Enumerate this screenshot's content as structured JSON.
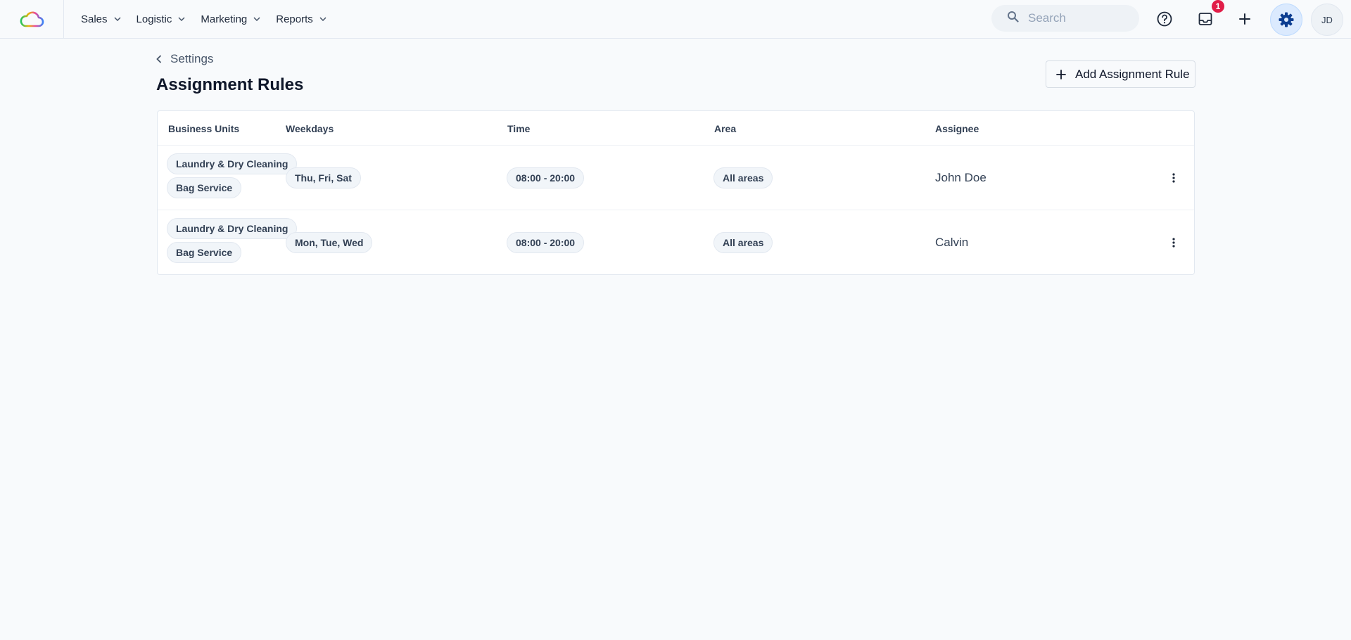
{
  "nav": {
    "items": [
      {
        "label": "Sales"
      },
      {
        "label": "Logistic"
      },
      {
        "label": "Marketing"
      },
      {
        "label": "Reports"
      }
    ]
  },
  "header": {
    "search_placeholder": "Search",
    "notification_count": "1",
    "avatar_initials": "JD",
    "accent_color": "#0b3d91",
    "badge_color": "#e11d48"
  },
  "page": {
    "back_label": "Settings",
    "title": "Assignment Rules",
    "add_button_label": "Add Assignment Rule"
  },
  "table": {
    "columns": [
      "Business Units",
      "Weekdays",
      "Time",
      "Area",
      "Assignee"
    ],
    "rows": [
      {
        "business_units": [
          "Laundry & Dry Cleaning",
          "Bag Service"
        ],
        "weekdays": "Thu, Fri, Sat",
        "time": "08:00 - 20:00",
        "area": "All areas",
        "assignee": "John Doe"
      },
      {
        "business_units": [
          "Laundry & Dry Cleaning",
          "Bag Service"
        ],
        "weekdays": "Mon, Tue, Wed",
        "time": "08:00 - 20:00",
        "area": "All areas",
        "assignee": "Calvin"
      }
    ]
  }
}
